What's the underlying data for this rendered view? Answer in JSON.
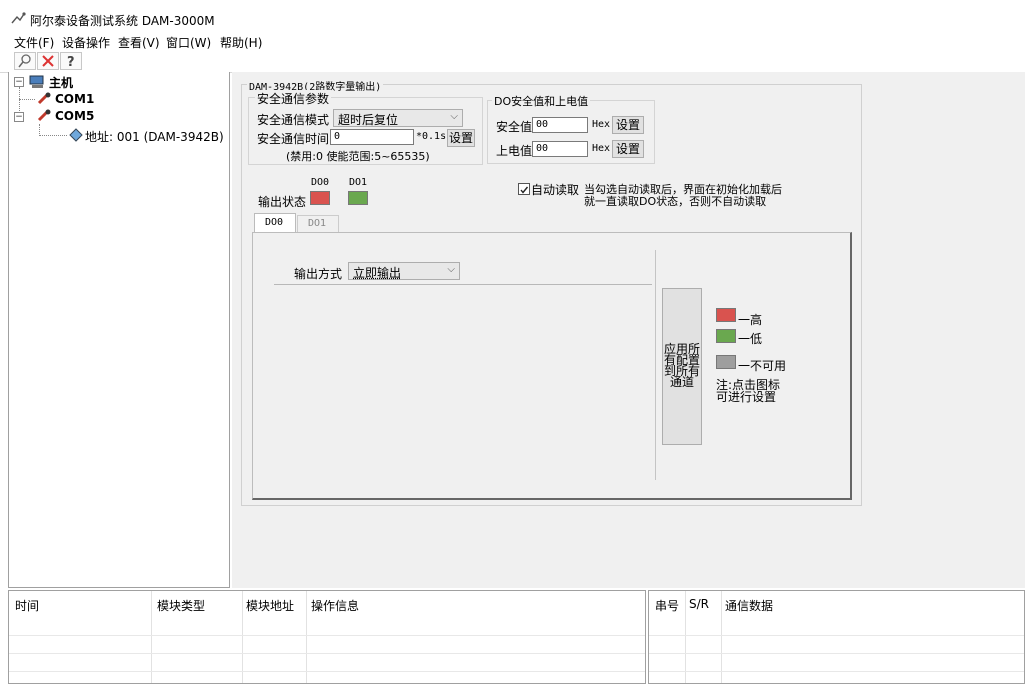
{
  "app": {
    "title": "阿尔泰设备测试系统 DAM-3000M"
  },
  "menu": [
    "文件(F)",
    "设备操作",
    "查看(V)",
    "窗口(W)",
    "帮助(H)"
  ],
  "toolbar": {
    "icons": [
      "search-icon",
      "close-icon",
      "help-icon"
    ]
  },
  "tree": {
    "root": "主机",
    "com1": "COM1",
    "com5": "COM5",
    "address": "地址: 001 (DAM-3942B)"
  },
  "module": {
    "title": "DAM-3942B(2路数字量输出)",
    "safe_comm": {
      "group_title": "安全通信参数",
      "mode_label": "安全通信模式",
      "mode_value": "超时后复位",
      "time_label": "安全通信时间",
      "time_value": "0",
      "time_unit": "*0.1s",
      "set_button": "设置",
      "note": "(禁用:0 使能范围:5~65535)"
    },
    "do_safe": {
      "group_title": "DO安全值和上电值",
      "safe_label": "安全值",
      "safe_value": "00",
      "power_label": "上电值",
      "power_value": "00",
      "hex": "Hex",
      "set_button": "设置"
    },
    "output_status": {
      "label": "输出状态",
      "ch0": "DO0",
      "ch1": "DO1",
      "ch0_color": "#d9534f",
      "ch1_color": "#6aa84f"
    },
    "auto_read": {
      "checked": true,
      "label": "自动读取",
      "note_line1": "当勾选自动读取后，界面在初始化加载后",
      "note_line2": "就一直读取DO状态，否则不自动读取"
    },
    "tabs": [
      "DO0",
      "DO1"
    ],
    "output_mode": {
      "label": "输出方式",
      "value": "立即输出"
    },
    "apply_button": [
      "应用所",
      "有配置",
      "到所有",
      "通道"
    ],
    "legend": [
      {
        "label": "一高",
        "color": "#d9534f"
      },
      {
        "label": "一低",
        "color": "#6aa84f"
      },
      {
        "label": "一不可用",
        "color": "#9e9e9e"
      }
    ],
    "legend_note": [
      "注:点击图标",
      "可进行设置"
    ]
  },
  "log": {
    "columns": [
      "时间",
      "模块类型",
      "模块地址",
      "操作信息"
    ],
    "comm_columns": [
      "串号",
      "S/R",
      "通信数据"
    ]
  }
}
